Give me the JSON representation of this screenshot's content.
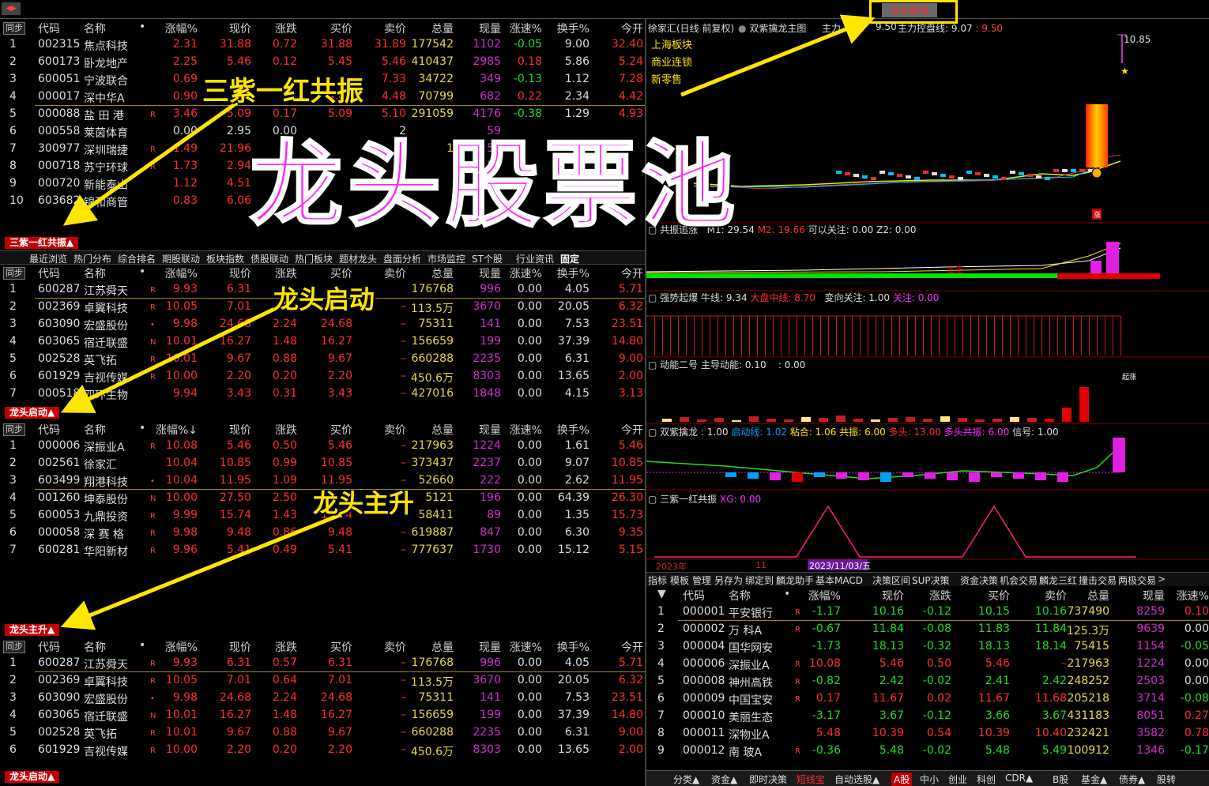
{
  "top": {
    "tab": "龙头股池",
    "nav": "◀▶"
  },
  "headers": {
    "sync": "同步",
    "code": "代码",
    "name": "名称",
    "dot": "•",
    "pct": "涨幅%",
    "price": "现价",
    "chg": "涨跌",
    "bid": "买价",
    "ask": "卖价",
    "vol": "总量",
    "now": "现量",
    "spd": "涨速%",
    "turn": "换手%",
    "open": "今开"
  },
  "panel1": {
    "tab": "三紫一红共振▲",
    "rows": [
      {
        "i": "1",
        "code": "002315",
        "name": "焦点科技",
        "flag": "",
        "pct": "2.31",
        "price": "31.88",
        "chg": "0.72",
        "bid": "31.88",
        "ask": "31.89",
        "vol": "177542",
        "now": "1102",
        "spd": "-0.05",
        "turn": "9.00",
        "open": "32.40"
      },
      {
        "i": "2",
        "code": "600173",
        "name": "卧龙地产",
        "flag": "",
        "pct": "2.25",
        "price": "5.46",
        "chg": "0.12",
        "bid": "5.45",
        "ask": "5.46",
        "vol": "410437",
        "now": "2985",
        "spd": "0.18",
        "turn": "5.86",
        "open": "5.24"
      },
      {
        "i": "3",
        "code": "600051",
        "name": "宁波联合",
        "flag": "",
        "pct": "0.69",
        "price": "",
        "chg": "",
        "bid": "",
        "ask": "7.33",
        "vol": "34722",
        "now": "349",
        "spd": "-0.13",
        "turn": "1.12",
        "open": "7.28"
      },
      {
        "i": "4",
        "code": "000017",
        "name": "深中华A",
        "flag": "",
        "pct": "0.90",
        "price": "",
        "chg": "",
        "bid": "4.47",
        "ask": "4.48",
        "vol": "70799",
        "now": "682",
        "spd": "0.22",
        "turn": "2.34",
        "open": "4.42"
      },
      {
        "i": "5",
        "code": "000088",
        "name": "盐 田 港",
        "flag": "R",
        "pct": "3.46",
        "price": "5.09",
        "chg": "0.17",
        "bid": "5.09",
        "ask": "5.10",
        "vol": "291059",
        "now": "4176",
        "spd": "-0.38",
        "turn": "1.29",
        "open": "4.93"
      },
      {
        "i": "6",
        "code": "000558",
        "name": "莱茵体育",
        "flag": "",
        "pct": "0.00",
        "price": "2.95",
        "chg": "0.00",
        "bid": "",
        "ask": "2",
        "vol": "",
        "now": "59",
        "spd": "",
        "turn": "",
        "open": ""
      },
      {
        "i": "7",
        "code": "300977",
        "name": "深圳瑞捷",
        "flag": "R",
        "pct": "1.49",
        "price": "21.96",
        "chg": "",
        "bid": "",
        "ask": "2",
        "vol": "1",
        "now": "254",
        "spd": "",
        "turn": "",
        "open": ""
      },
      {
        "i": "8",
        "code": "000718",
        "name": "苏宁环球",
        "flag": "R",
        "pct": "1.73",
        "price": "2.94",
        "chg": "",
        "bid": "",
        "ask": "",
        "vol": "",
        "now": "251",
        "spd": "",
        "turn": "",
        "open": ""
      },
      {
        "i": "9",
        "code": "000720",
        "name": "新能泰山",
        "flag": "",
        "pct": "1.12",
        "price": "4.51",
        "chg": "",
        "bid": "",
        "ask": "",
        "vol": "",
        "now": "195",
        "spd": "",
        "turn": "",
        "open": ""
      },
      {
        "i": "10",
        "code": "603682",
        "name": "锦和商管",
        "flag": "",
        "pct": "0.83",
        "price": "6.06",
        "chg": "",
        "bid": "",
        "ask": "",
        "vol": "",
        "now": "5",
        "spd": "",
        "turn": "",
        "open": ""
      }
    ]
  },
  "nav": [
    "最近浏览",
    "热门分布",
    "综合排名",
    "期股联动",
    "板块指数",
    "债股联动",
    "热门板块",
    "题材龙头",
    "盘面分析",
    "市场监控",
    "ST个股",
    "行业资讯",
    "固定"
  ],
  "panel2": {
    "tab": "龙头启动▲",
    "rows": [
      {
        "i": "1",
        "code": "600287",
        "name": "江苏舜天",
        "flag": "R",
        "pct": "9.93",
        "price": "6.31",
        "chg": "",
        "bid": "",
        "ask": "",
        "vol": "176768",
        "now": "996",
        "spd": "0.00",
        "turn": "4.05",
        "open": "5.71"
      },
      {
        "i": "2",
        "code": "002369",
        "name": "卓翼科技",
        "flag": "R",
        "pct": "10.05",
        "price": "7.01",
        "chg": "",
        "bid": "",
        "ask": "–",
        "vol": "113.5万",
        "now": "3670",
        "spd": "0.00",
        "turn": "20.05",
        "open": "6.32"
      },
      {
        "i": "3",
        "code": "603090",
        "name": "宏盛股份",
        "flag": "•",
        "pct": "9.98",
        "price": "24.68",
        "chg": "2.24",
        "bid": "24.68",
        "ask": "–",
        "vol": "75311",
        "now": "141",
        "spd": "0.00",
        "turn": "7.53",
        "open": "23.51"
      },
      {
        "i": "4",
        "code": "603065",
        "name": "宿迁联盛",
        "flag": "N",
        "pct": "10.01",
        "price": "16.27",
        "chg": "1.48",
        "bid": "16.27",
        "ask": "–",
        "vol": "156659",
        "now": "199",
        "spd": "0.00",
        "turn": "37.39",
        "open": "14.80"
      },
      {
        "i": "5",
        "code": "002528",
        "name": "英飞拓",
        "flag": "R",
        "pct": "10.01",
        "price": "9.67",
        "chg": "0.88",
        "bid": "9.67",
        "ask": "–",
        "vol": "660288",
        "now": "2235",
        "spd": "0.00",
        "turn": "6.31",
        "open": "9.00"
      },
      {
        "i": "6",
        "code": "601929",
        "name": "吉视传媒",
        "flag": "R",
        "pct": "10.00",
        "price": "2.20",
        "chg": "0.20",
        "bid": "2.20",
        "ask": "–",
        "vol": "450.6万",
        "now": "8303",
        "spd": "0.00",
        "turn": "13.65",
        "open": "2.00"
      },
      {
        "i": "7",
        "code": "000518",
        "name": "四环生物",
        "flag": "",
        "pct": "9.94",
        "price": "3.43",
        "chg": "0.31",
        "bid": "3.43",
        "ask": "–",
        "vol": "427016",
        "now": "1848",
        "spd": "0.00",
        "turn": "4.15",
        "open": "3.13"
      }
    ]
  },
  "panel3": {
    "tab": "龙头主升▲",
    "pctHeader": "涨幅%↓",
    "rows": [
      {
        "i": "1",
        "code": "000006",
        "name": "深振业A",
        "flag": "R",
        "pct": "10.08",
        "price": "5.46",
        "chg": "0.50",
        "bid": "5.46",
        "ask": "–",
        "vol": "217963",
        "now": "1224",
        "spd": "0.00",
        "turn": "1.61",
        "open": "5.46"
      },
      {
        "i": "2",
        "code": "002561",
        "name": "徐家汇",
        "flag": "",
        "pct": "10.04",
        "price": "10.85",
        "chg": "0.99",
        "bid": "10.85",
        "ask": "–",
        "vol": "373437",
        "now": "2237",
        "spd": "0.00",
        "turn": "9.07",
        "open": "10.85"
      },
      {
        "i": "3",
        "code": "603499",
        "name": "翔港科技",
        "flag": "•",
        "pct": "10.04",
        "price": "11.95",
        "chg": "1.09",
        "bid": "11.95",
        "ask": "–",
        "vol": "52660",
        "now": "222",
        "spd": "0.00",
        "turn": "2.62",
        "open": "11.95"
      },
      {
        "i": "4",
        "code": "001260",
        "name": "坤泰股份",
        "flag": "N",
        "pct": "10.00",
        "price": "27.50",
        "chg": "2.50",
        "bid": "",
        "ask": "",
        "vol": "5121",
        "now": "196",
        "spd": "0.00",
        "turn": "64.39",
        "open": "26.30"
      },
      {
        "i": "5",
        "code": "600053",
        "name": "九鼎投资",
        "flag": "R",
        "pct": "9.99",
        "price": "15.74",
        "chg": "1.43",
        "bid": "15.74",
        "ask": "",
        "vol": "58411",
        "now": "89",
        "spd": "0.00",
        "turn": "1.35",
        "open": "15.73"
      },
      {
        "i": "6",
        "code": "000058",
        "name": "深 赛 格",
        "flag": "R",
        "pct": "9.98",
        "price": "9.48",
        "chg": "0.86",
        "bid": "9.48",
        "ask": "–",
        "vol": "619887",
        "now": "847",
        "spd": "0.00",
        "turn": "6.30",
        "open": "9.35"
      },
      {
        "i": "7",
        "code": "600281",
        "name": "华阳新材",
        "flag": "R",
        "pct": "9.96",
        "price": "5.41",
        "chg": "0.49",
        "bid": "5.41",
        "ask": "–",
        "vol": "777637",
        "now": "1730",
        "spd": "0.00",
        "turn": "15.12",
        "open": "5.15"
      }
    ]
  },
  "panel4": {
    "tab": "龙头启动▲",
    "rows": [
      {
        "i": "1",
        "code": "600287",
        "name": "江苏舜天",
        "flag": "R",
        "pct": "9.93",
        "price": "6.31",
        "chg": "0.57",
        "bid": "6.31",
        "ask": "–",
        "vol": "176768",
        "now": "996",
        "spd": "0.00",
        "turn": "4.05",
        "open": "5.71"
      },
      {
        "i": "2",
        "code": "002369",
        "name": "卓翼科技",
        "flag": "R",
        "pct": "10.05",
        "price": "7.01",
        "chg": "0.64",
        "bid": "7.01",
        "ask": "–",
        "vol": "113.5万",
        "now": "3670",
        "spd": "0.00",
        "turn": "20.05",
        "open": "6.32"
      },
      {
        "i": "3",
        "code": "603090",
        "name": "宏盛股份",
        "flag": "•",
        "pct": "9.98",
        "price": "24.68",
        "chg": "2.24",
        "bid": "24.68",
        "ask": "–",
        "vol": "75311",
        "now": "141",
        "spd": "0.00",
        "turn": "7.53",
        "open": "23.51"
      },
      {
        "i": "4",
        "code": "603065",
        "name": "宿迁联盛",
        "flag": "N",
        "pct": "10.01",
        "price": "16.27",
        "chg": "1.48",
        "bid": "16.27",
        "ask": "–",
        "vol": "156659",
        "now": "199",
        "spd": "0.00",
        "turn": "37.39",
        "open": "14.80"
      },
      {
        "i": "5",
        "code": "002528",
        "name": "英飞拓",
        "flag": "R",
        "pct": "10.01",
        "price": "9.67",
        "chg": "0.88",
        "bid": "9.67",
        "ask": "–",
        "vol": "660288",
        "now": "2235",
        "spd": "0.00",
        "turn": "6.31",
        "open": "9.00"
      },
      {
        "i": "6",
        "code": "601929",
        "name": "吉视传媒",
        "flag": "R",
        "pct": "10.00",
        "price": "2.20",
        "chg": "0.20",
        "bid": "2.20",
        "ask": "–",
        "vol": "450.6万",
        "now": "8303",
        "spd": "0.00",
        "turn": "13.65",
        "open": "2.00"
      }
    ]
  },
  "annotations": {
    "a1": "三紫一红共振",
    "a2": "龙头启动",
    "a3": "龙头主升",
    "big": "龙头股票池"
  },
  "chart": {
    "title": "徐家汇(日线 前复权)",
    "indicator": "双紫擒龙主图",
    "main1": "主力",
    "main1v": "9.50",
    "main2": "主力控盘线:",
    "main2v": "9.07",
    "main2v2": "9.50",
    "sectors": [
      "上海板块",
      "商业连锁",
      "新零售"
    ],
    "high": "10.85",
    "zhang": "涨",
    "chudi": "出击",
    "sub1": {
      "name": "共振追涨",
      "m1": "M1: 29.54",
      "m2": "M2: 19.66",
      "k": "可以关注: 0.00",
      "z2": "Z2: 0.00"
    },
    "sub2": {
      "name": "强势起爆",
      "a": "牛线: 9.34",
      "b": "大盘中线: 8.70",
      "c": "变向关注: 1.00",
      "d": "关注: 0.00"
    },
    "sub3": {
      "name": "动能二号",
      "a": "主导动能: 0.10",
      "b": ": 0.00",
      "c": "起涨"
    },
    "sub4": {
      "name": "双紫擒龙",
      "a": ": 1.00",
      "b": "启动线: 1.02",
      "c": "粘合: 1.06",
      "d": "共振: 6.00",
      "e": "多头: 13.00",
      "f": "多头共振: 6.00",
      "g": "信号: 1.00"
    },
    "sub5": {
      "name": "三紫一红共振",
      "a": "XG: 0.00"
    },
    "years": {
      "y": "2023年",
      "m": "11",
      "d": "2023/11/03/五"
    }
  },
  "rtoolbar": [
    "指标",
    "模板",
    "管理",
    "另存为",
    "绑定到",
    "麟龙助手",
    "基本MACD",
    "决策区间",
    "SUP决策",
    "资金决策",
    "机会交易",
    "麟龙三红",
    "撞击交易",
    "两极交易",
    ">"
  ],
  "rtable": {
    "headers": {
      "arrow": "▼",
      "code": "代码",
      "name": "名称",
      "dot": "•",
      "pct": "涨幅%",
      "price": "现价",
      "chg": "涨跌",
      "bid": "买价",
      "ask": "卖价",
      "vol": "总量",
      "now": "现量",
      "spd": "涨速%",
      "last": "换"
    },
    "rows": [
      {
        "i": "1",
        "code": "000001",
        "name": "平安银行",
        "flag": "R",
        "pct": "-1.17",
        "price": "10.16",
        "chg": "-0.12",
        "bid": "10.15",
        "ask": "10.16",
        "vol": "737490",
        "now": "8259",
        "spd": "0.10"
      },
      {
        "i": "2",
        "code": "000002",
        "name": "万 科A",
        "flag": "R",
        "pct": "-0.67",
        "price": "11.84",
        "chg": "-0.08",
        "bid": "11.83",
        "ask": "11.84",
        "vol": "125.3万",
        "now": "9639",
        "spd": "0.00"
      },
      {
        "i": "3",
        "code": "000004",
        "name": "国华网安",
        "flag": "",
        "pct": "-1.73",
        "price": "18.13",
        "chg": "-0.32",
        "bid": "18.13",
        "ask": "18.14",
        "vol": "75415",
        "now": "1154",
        "spd": "-0.05"
      },
      {
        "i": "4",
        "code": "000006",
        "name": "深振业A",
        "flag": "R",
        "pct": "10.08",
        "price": "5.46",
        "chg": "0.50",
        "bid": "5.46",
        "ask": "–",
        "vol": "217963",
        "now": "1224",
        "spd": "0.00"
      },
      {
        "i": "5",
        "code": "000008",
        "name": "神州高铁",
        "flag": "R",
        "pct": "-0.82",
        "price": "2.42",
        "chg": "-0.02",
        "bid": "2.41",
        "ask": "2.42",
        "vol": "248252",
        "now": "2503",
        "spd": "0.00"
      },
      {
        "i": "6",
        "code": "000009",
        "name": "中国宝安",
        "flag": "R",
        "pct": "0.17",
        "price": "11.67",
        "chg": "0.02",
        "bid": "11.67",
        "ask": "11.68",
        "vol": "205218",
        "now": "3714",
        "spd": "-0.08"
      },
      {
        "i": "7",
        "code": "000010",
        "name": "美丽生态",
        "flag": "",
        "pct": "-3.17",
        "price": "3.67",
        "chg": "-0.12",
        "bid": "3.66",
        "ask": "3.67",
        "vol": "431183",
        "now": "8051",
        "spd": "0.27"
      },
      {
        "i": "8",
        "code": "000011",
        "name": "深物业A",
        "flag": "",
        "pct": "5.48",
        "price": "10.39",
        "chg": "0.54",
        "bid": "10.39",
        "ask": "10.40",
        "vol": "232421",
        "now": "3582",
        "spd": "0.78"
      },
      {
        "i": "9",
        "code": "000012",
        "name": "南 玻A",
        "flag": "R",
        "pct": "-0.36",
        "price": "5.48",
        "chg": "-0.02",
        "bid": "5.48",
        "ask": "5.49",
        "vol": "100912",
        "now": "1346",
        "spd": "-0.17"
      }
    ]
  },
  "bottombar": [
    "分类▲",
    "资金▲",
    "即时决策",
    "短线宝",
    "自动选股▲",
    "A股",
    "中小",
    "创业",
    "科创",
    "CDR▲",
    "B股",
    "基金▲",
    "债券▲",
    "股转"
  ]
}
